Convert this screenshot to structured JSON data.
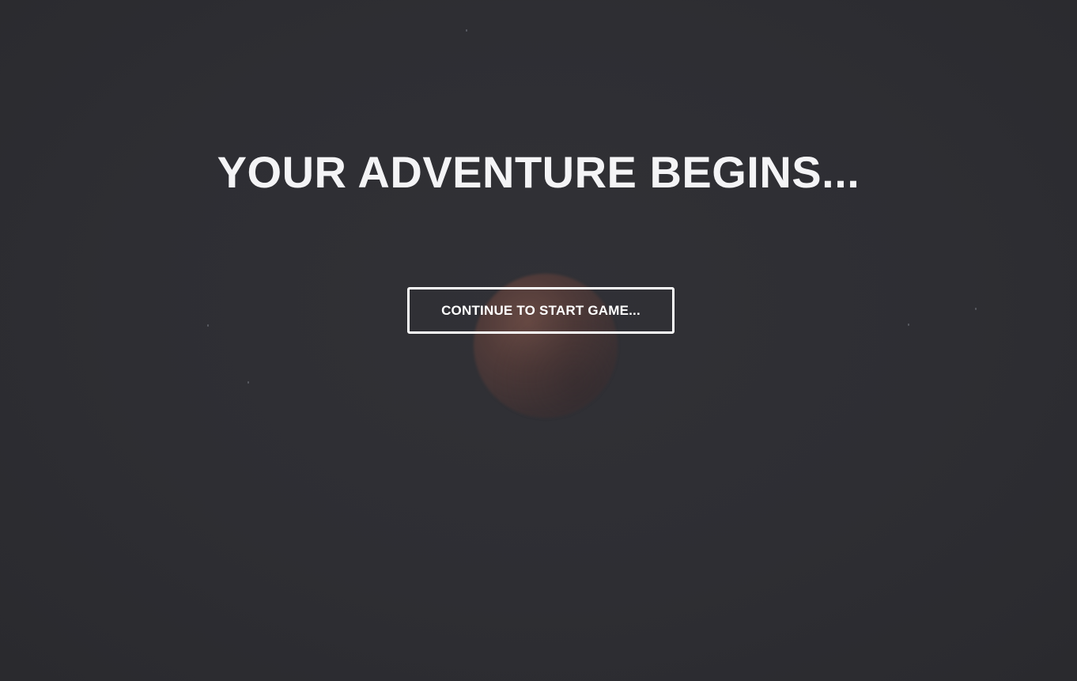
{
  "screen": {
    "title": "YOUR ADVENTURE BEGINS...",
    "continue_label": "CONTINUE TO START GAME...",
    "background_color": "#2d2d31",
    "text_color": "#ffffff"
  },
  "background": {
    "image": "blood-moon-night-sky"
  }
}
